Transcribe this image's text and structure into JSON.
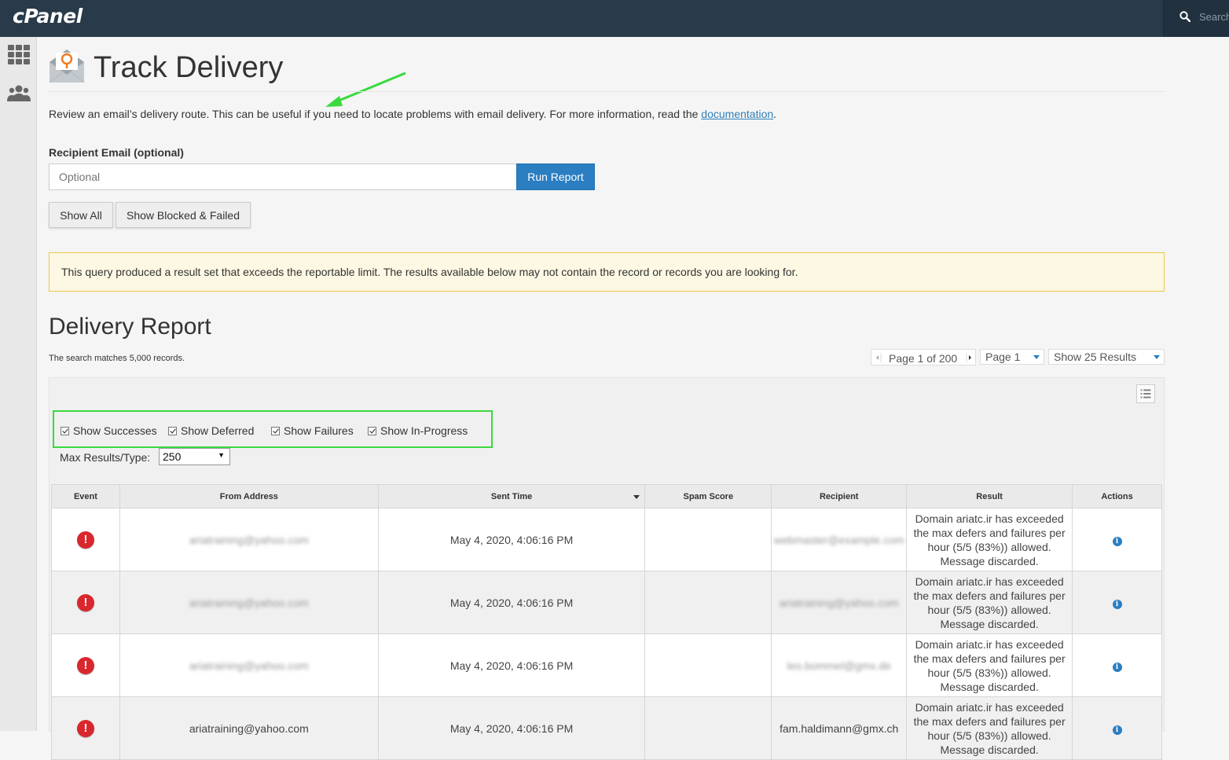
{
  "topbar": {
    "logo": "cPanel",
    "search_label": "Search"
  },
  "page": {
    "title": "Track Delivery",
    "description_before": "Review an email’s delivery route. This can be useful if you need to locate problems with email delivery. For more information, read the ",
    "description_link": "documentation",
    "description_after": "."
  },
  "form": {
    "recipient_label": "Recipient Email (optional)",
    "recipient_placeholder": "Optional",
    "run_report_label": "Run Report",
    "show_all_label": "Show All",
    "show_blocked_label": "Show Blocked & Failed"
  },
  "warning": "This query produced a result set that exceeds the reportable limit. The results available below may not contain the record or records you are looking for.",
  "report": {
    "title": "Delivery Report",
    "matches": "The search matches 5,000 records.",
    "pager_text": "Page 1 of 200",
    "page_select": "Page 1",
    "results_select": "Show 25 Results",
    "filters": {
      "successes": "Show Successes",
      "deferred": "Show Deferred",
      "failures": "Show Failures",
      "in_progress": "Show In-Progress"
    },
    "max_results_label": "Max Results/Type:",
    "max_results_value": "250",
    "columns": [
      "Event",
      "From Address",
      "Sent Time",
      "Spam Score",
      "Recipient",
      "Result",
      "Actions"
    ],
    "rows": [
      {
        "from": "ariatraining@yahoo.com",
        "sent": "May 4, 2020, 4:06:16 PM",
        "spam": "",
        "recipient": "webmaster@example.com",
        "result": "Domain ariatc.ir has exceeded the max defers and failures per hour (5/5 (83%)) allowed. Message discarded."
      },
      {
        "from": "ariatraining@yahoo.com",
        "sent": "May 4, 2020, 4:06:16 PM",
        "spam": "",
        "recipient": "ariatraining@yahoo.com",
        "result": "Domain ariatc.ir has exceeded the max defers and failures per hour (5/5 (83%)) allowed. Message discarded."
      },
      {
        "from": "ariatraining@yahoo.com",
        "sent": "May 4, 2020, 4:06:16 PM",
        "spam": "",
        "recipient": "leo.bommel@gmx.de",
        "result": "Domain ariatc.ir has exceeded the max defers and failures per hour (5/5 (83%)) allowed. Message discarded."
      },
      {
        "from": "ariatraining@yahoo.com",
        "sent": "May 4, 2020, 4:06:16 PM",
        "spam": "",
        "recipient": "fam.haldimann@gmx.ch",
        "result": "Domain ariatc.ir has exceeded the max defers and failures per hour (5/5 (83%)) allowed. Message discarded."
      }
    ]
  },
  "colors": {
    "topbar": "#293a4a",
    "primary": "#2a7ec1",
    "error": "#d9272e",
    "highlight": "#39d93f",
    "warning_bg": "#fcf8e3"
  }
}
